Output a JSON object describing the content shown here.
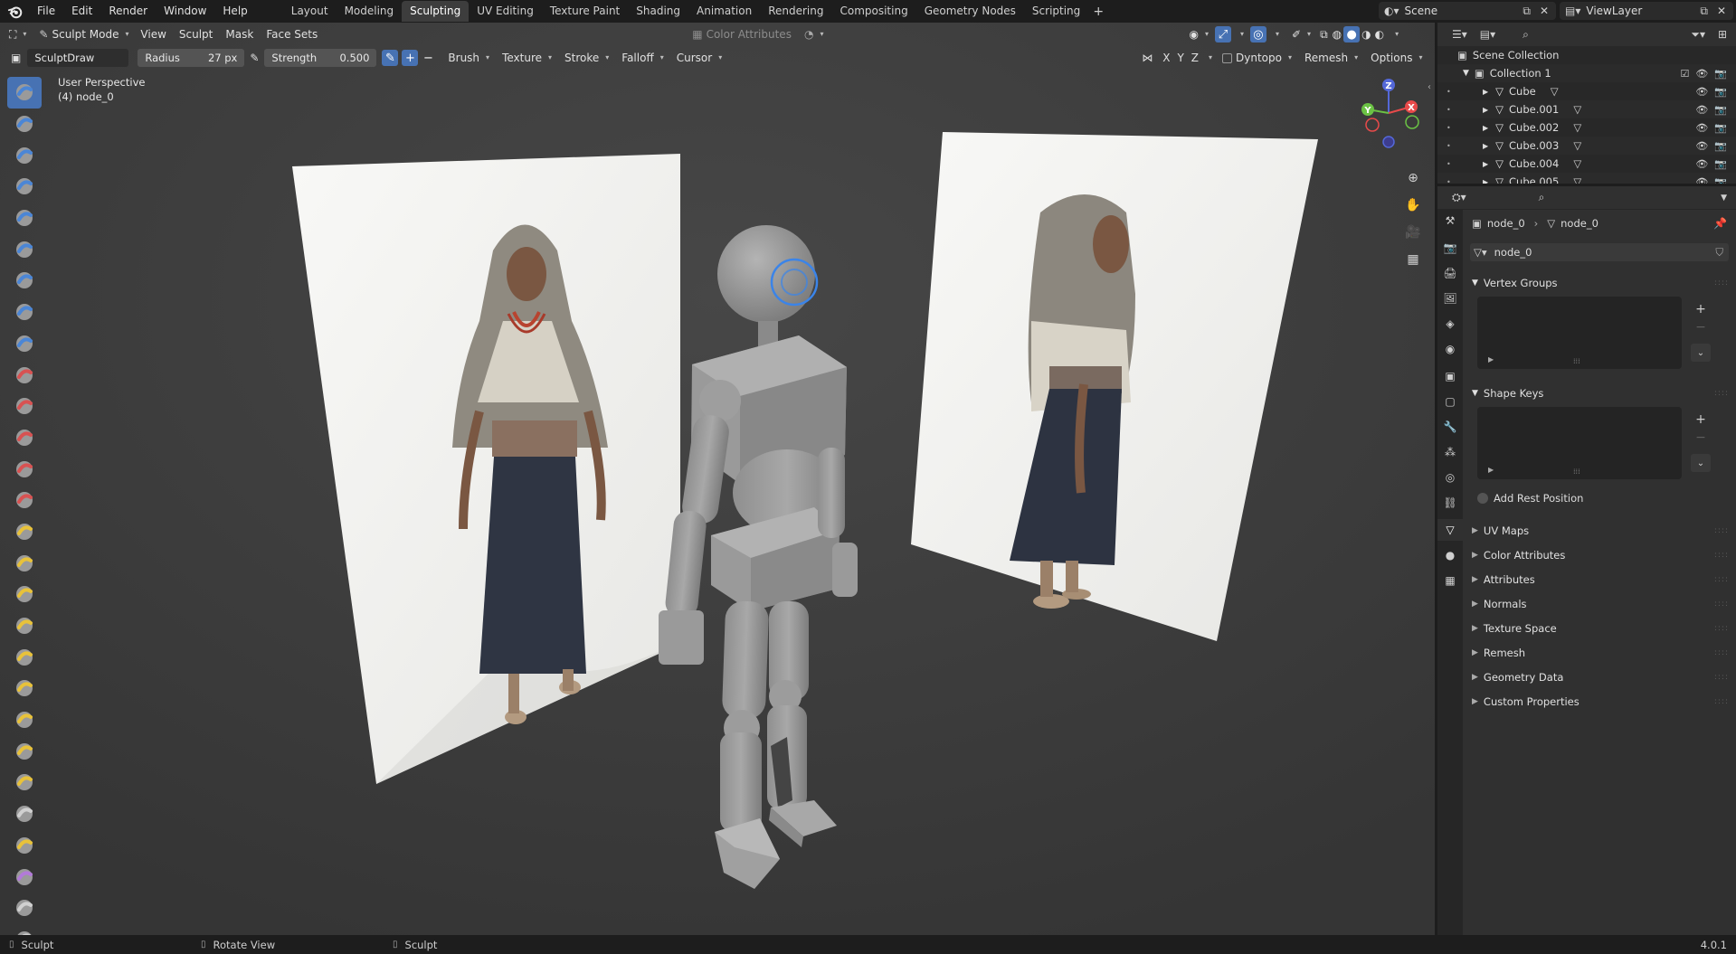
{
  "menu": {
    "items": [
      "File",
      "Edit",
      "Render",
      "Window",
      "Help"
    ]
  },
  "workspaces": {
    "tabs": [
      "Layout",
      "Modeling",
      "Sculpting",
      "UV Editing",
      "Texture Paint",
      "Shading",
      "Animation",
      "Rendering",
      "Compositing",
      "Geometry Nodes",
      "Scripting"
    ],
    "active": "Sculpting"
  },
  "scene": {
    "name": "Scene"
  },
  "view_layer": {
    "name": "ViewLayer"
  },
  "viewport_header": {
    "mode": "Sculpt Mode",
    "menus": [
      "View",
      "Sculpt",
      "Mask",
      "Face Sets"
    ],
    "color_attributes": "Color Attributes"
  },
  "tool_header": {
    "brush_name": "SculptDraw",
    "radius_label": "Radius",
    "radius_value": "27 px",
    "strength_label": "Strength",
    "strength_value": "0.500",
    "dropdowns": [
      "Brush",
      "Texture",
      "Stroke",
      "Falloff",
      "Cursor"
    ],
    "axes": [
      "X",
      "Y",
      "Z"
    ],
    "dyntopo": "Dyntopo",
    "remesh": "Remesh",
    "options": "Options"
  },
  "viewport_info": {
    "view_name": "User Perspective",
    "object_line": "(4) node_0"
  },
  "gizmo": {
    "x": "X",
    "y": "Y",
    "z": "Z"
  },
  "outliner": {
    "root": "Scene Collection",
    "collection": "Collection 1",
    "objects": [
      "Cube",
      "Cube.001",
      "Cube.002",
      "Cube.003",
      "Cube.004",
      "Cube.005"
    ]
  },
  "properties": {
    "breadcrumb_object": "node_0",
    "breadcrumb_data": "node_0",
    "mesh_name": "node_0",
    "vertex_groups": "Vertex Groups",
    "shape_keys": "Shape Keys",
    "add_rest_position": "Add Rest Position",
    "collapsed_panels": [
      "UV Maps",
      "Color Attributes",
      "Attributes",
      "Normals",
      "Texture Space",
      "Remesh",
      "Geometry Data",
      "Custom Properties"
    ]
  },
  "statusbar": {
    "left": "Sculpt",
    "middle": "Rotate View",
    "right": "Sculpt",
    "version": "4.0.1"
  },
  "colors": {
    "accent": "#4772b3",
    "viewport_bg": "#3d3d3d",
    "axis_x": "#e84a4a",
    "axis_y": "#6bc244",
    "axis_z": "#5468d8"
  }
}
